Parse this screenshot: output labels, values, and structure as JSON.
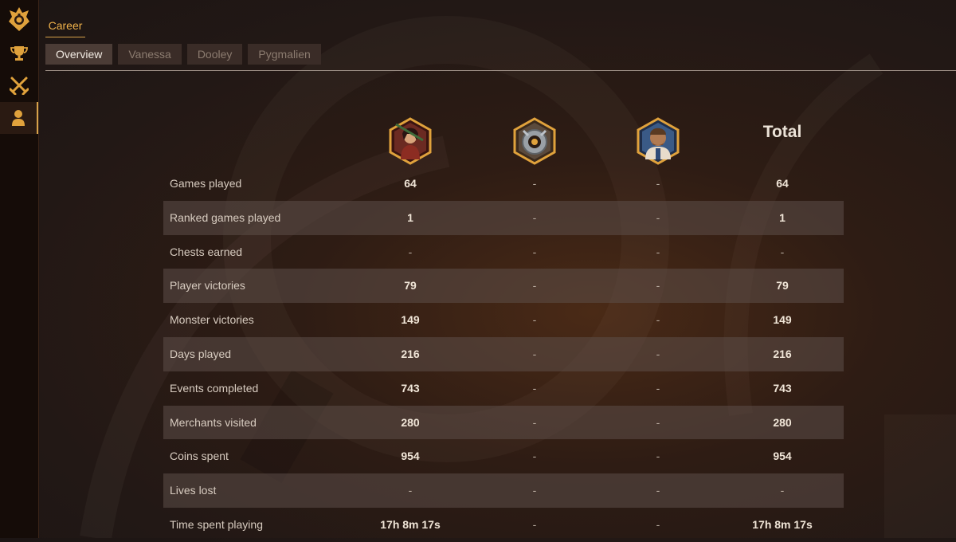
{
  "nav": {
    "career_tab": "Career",
    "subtabs": [
      "Overview",
      "Vanessa",
      "Dooley",
      "Pygmalien"
    ],
    "active_subtab": "Overview"
  },
  "sidebar": {
    "items": [
      {
        "icon": "bazaar-emblem-icon",
        "active": false
      },
      {
        "icon": "trophy-icon",
        "active": false
      },
      {
        "icon": "crossed-swords-icon",
        "active": false
      },
      {
        "icon": "profile-icon",
        "active": true
      }
    ]
  },
  "columns": {
    "heroes": [
      {
        "icon": "vanessa-portrait-icon"
      },
      {
        "icon": "dooley-portrait-icon"
      },
      {
        "icon": "pygmalien-portrait-icon"
      }
    ],
    "total": "Total"
  },
  "rows": [
    {
      "label": "Games played",
      "values": [
        "64",
        "-",
        "-",
        "64"
      ]
    },
    {
      "label": "Ranked games played",
      "values": [
        "1",
        "-",
        "-",
        "1"
      ]
    },
    {
      "label": "Chests earned",
      "values": [
        "-",
        "-",
        "-",
        "-"
      ]
    },
    {
      "label": "Player victories",
      "values": [
        "79",
        "-",
        "-",
        "79"
      ]
    },
    {
      "label": "Monster victories",
      "values": [
        "149",
        "-",
        "-",
        "149"
      ]
    },
    {
      "label": "Days played",
      "values": [
        "216",
        "-",
        "-",
        "216"
      ]
    },
    {
      "label": "Events completed",
      "values": [
        "743",
        "-",
        "-",
        "743"
      ]
    },
    {
      "label": "Merchants visited",
      "values": [
        "280",
        "-",
        "-",
        "280"
      ]
    },
    {
      "label": "Coins spent",
      "values": [
        "954",
        "-",
        "-",
        "954"
      ]
    },
    {
      "label": "Lives lost",
      "values": [
        "-",
        "-",
        "-",
        "-"
      ]
    },
    {
      "label": "Time spent playing",
      "values": [
        "17h 8m 17s",
        "-",
        "-",
        "17h 8m 17s"
      ]
    }
  ],
  "colors": {
    "accent": "#d7a24a",
    "active_tab": "#4b3c36",
    "row_shade": "#5c4e48"
  }
}
